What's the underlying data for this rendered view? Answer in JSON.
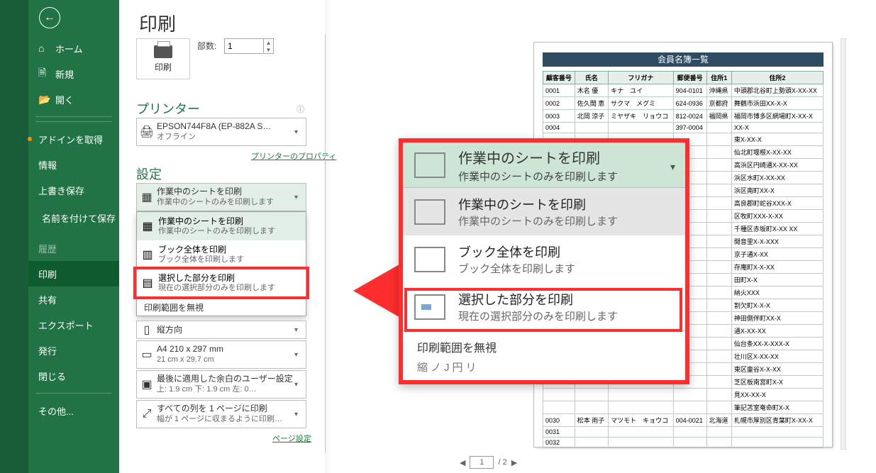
{
  "page_title": "印刷",
  "sidebar": {
    "back": "←",
    "items": [
      {
        "icon": "⌂",
        "label": "ホーム"
      },
      {
        "icon": "🗎",
        "label": "新規"
      },
      {
        "icon": "📂",
        "label": "開く"
      },
      {
        "icon": "",
        "label": "アドインを取得",
        "dot": true
      },
      {
        "icon": "",
        "label": "情報"
      },
      {
        "icon": "",
        "label": "上書き保存"
      },
      {
        "icon": "",
        "label": "名前を付けて保存",
        "tall": true
      },
      {
        "icon": "",
        "label": "履歴",
        "disabled": true
      },
      {
        "icon": "",
        "label": "印刷",
        "selected": true
      },
      {
        "icon": "",
        "label": "共有"
      },
      {
        "icon": "",
        "label": "エクスポート"
      },
      {
        "icon": "",
        "label": "発行"
      },
      {
        "icon": "",
        "label": "閉じる"
      },
      {
        "icon": "",
        "label": "その他..."
      }
    ]
  },
  "print_btn": "印刷",
  "copies_label": "部数:",
  "copies_value": "1",
  "printer_section": "プリンター",
  "printer": {
    "name": "EPSON744F8A (EP-882A S…",
    "status": "オフライン"
  },
  "printer_props": "プリンターのプロパティ",
  "settings_section": "設定",
  "settings_selected": {
    "title": "作業中のシートを印刷",
    "sub": "作業中のシートのみを印刷します"
  },
  "dd_options": [
    {
      "title": "作業中のシートを印刷",
      "sub": "作業中のシートのみを印刷します"
    },
    {
      "title": "ブック全体を印刷",
      "sub": "ブック全体を印刷します"
    },
    {
      "title": "選択した部分を印刷",
      "sub": "現在の選択部分のみを印刷します"
    }
  ],
  "dd_footer": "印刷範囲を無視",
  "orientation": "縦方向",
  "paper": {
    "t": "A4 210 x 297 mm",
    "s": "21 cm x 29.7 cm"
  },
  "margins": {
    "t": "最後に適用した余白のユーザー設定",
    "s": "上: 1.9 cm 下: 1.9 cm 左: 0…"
  },
  "scaling": {
    "t": "すべての列を 1 ページに印刷",
    "s": "幅が 1 ページに収まるように印刷…"
  },
  "page_setup": "ページ設定",
  "callout": {
    "hdr_t": "作業中のシートを印刷",
    "hdr_s": "作業中のシートのみを印刷します",
    "r1_t": "作業中のシートを印刷",
    "r1_s": "作業中のシートのみを印刷します",
    "r2_t": "ブック全体を印刷",
    "r2_s": "ブック全体を印刷します",
    "r3_t": "選択した部分を印刷",
    "r3_s": "現在の選択部分のみを印刷します",
    "footer": "印刷範囲を無視",
    "cut": "縮ノJ円リ"
  },
  "pager": {
    "page": "1",
    "total": "/ 2"
  },
  "preview": {
    "title": "会員名簿一覧",
    "headers": [
      "顧客番号",
      "氏名",
      "フリガナ",
      "郵便番号",
      "住所1",
      "住所2"
    ],
    "rows": [
      [
        "0001",
        "木名 優",
        "キナ　ユイ",
        "904-0101",
        "沖縄県",
        "中頭郡北谷町上勢頭X-XX-XX"
      ],
      [
        "0002",
        "佐久間 恵",
        "サクマ　メグミ",
        "624-0936",
        "京都府",
        "舞鶴市浜田XX-X-X"
      ],
      [
        "0003",
        "北岡 涼子",
        "ミヤザキ　リョウコ",
        "812-0024",
        "福岡県",
        "福岡市博多区網場町X-XX-X"
      ],
      [
        "0004",
        "",
        "",
        "397-0004",
        "",
        "XX-X"
      ],
      [
        "",
        "",
        "",
        "",
        "",
        "東X-XX-X"
      ],
      [
        "",
        "",
        "",
        "",
        "",
        "仙北町堰根X-XX-XX"
      ],
      [
        "",
        "",
        "",
        "",
        "",
        "高浜区円崎通X-XX-XX"
      ],
      [
        "",
        "",
        "",
        "",
        "",
        "浜区水町X-XX-XX"
      ],
      [
        "",
        "",
        "",
        "",
        "",
        "浜区南町XX-X"
      ],
      [
        "",
        "",
        "",
        "",
        "",
        "高良郡町蛇谷XXX-X"
      ],
      [
        "",
        "",
        "",
        "",
        "",
        "区牧町XXX-X-XX"
      ],
      [
        "",
        "",
        "",
        "",
        "",
        "千種区赤坂町X-XX XX"
      ],
      [
        "",
        "",
        "",
        "",
        "",
        "開音里X-X-XXX"
      ],
      [
        "",
        "",
        "",
        "",
        "",
        "京子通X-XX"
      ],
      [
        "",
        "",
        "",
        "",
        "",
        "存庵町X-X-XX"
      ],
      [
        "",
        "",
        "",
        "",
        "",
        "田町X-X"
      ],
      [
        "",
        "",
        "",
        "",
        "",
        "納火XXX"
      ],
      [
        "",
        "",
        "",
        "",
        "",
        "割欠町X-X-X"
      ],
      [
        "",
        "",
        "",
        "",
        "",
        "神田側伴町XX-X"
      ],
      [
        "",
        "",
        "",
        "",
        "",
        "通X-XX-XX"
      ],
      [
        "",
        "",
        "",
        "",
        "",
        "仙台条XX-X-XXX-X"
      ],
      [
        "",
        "",
        "",
        "",
        "",
        "壮川区X-XX-XX"
      ],
      [
        "",
        "",
        "",
        "",
        "",
        "東区壷谷X-X-XX"
      ],
      [
        "",
        "",
        "",
        "",
        "",
        "芝区板南宮町X-X"
      ],
      [
        "",
        "",
        "",
        "",
        "",
        "見XX-XX-X"
      ],
      [
        "",
        "",
        "",
        "",
        "",
        "筆記苫室奄命町X-X"
      ],
      [
        "0030",
        "松本 雨子",
        "マツモト　キョウコ",
        "004-0021",
        "北海道",
        "札幌市厚別区青葉町X-XX-X"
      ],
      [
        "0031",
        "",
        "",
        "",
        "",
        ""
      ],
      [
        "0032",
        "",
        "",
        "",
        "",
        ""
      ]
    ]
  }
}
